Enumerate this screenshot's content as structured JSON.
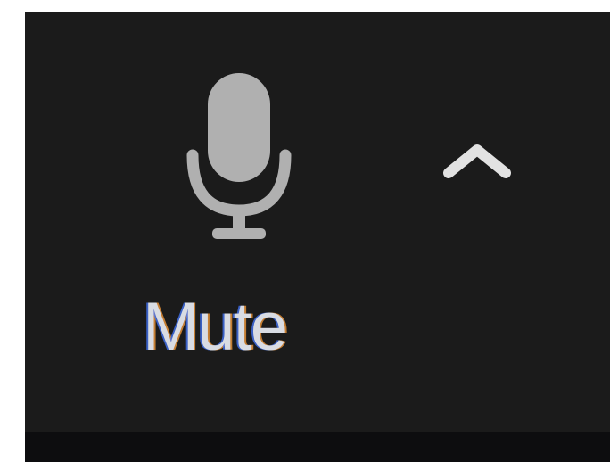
{
  "toolbar": {
    "mute_button": {
      "label": "Mute",
      "icon": "microphone-icon"
    },
    "audio_options_button": {
      "icon": "chevron-up-icon"
    }
  },
  "colors": {
    "background": "#1b1b1b",
    "bottom_strip": "#0d0d0f",
    "icon": "#b0b0b0",
    "label": "#d9dce3"
  }
}
